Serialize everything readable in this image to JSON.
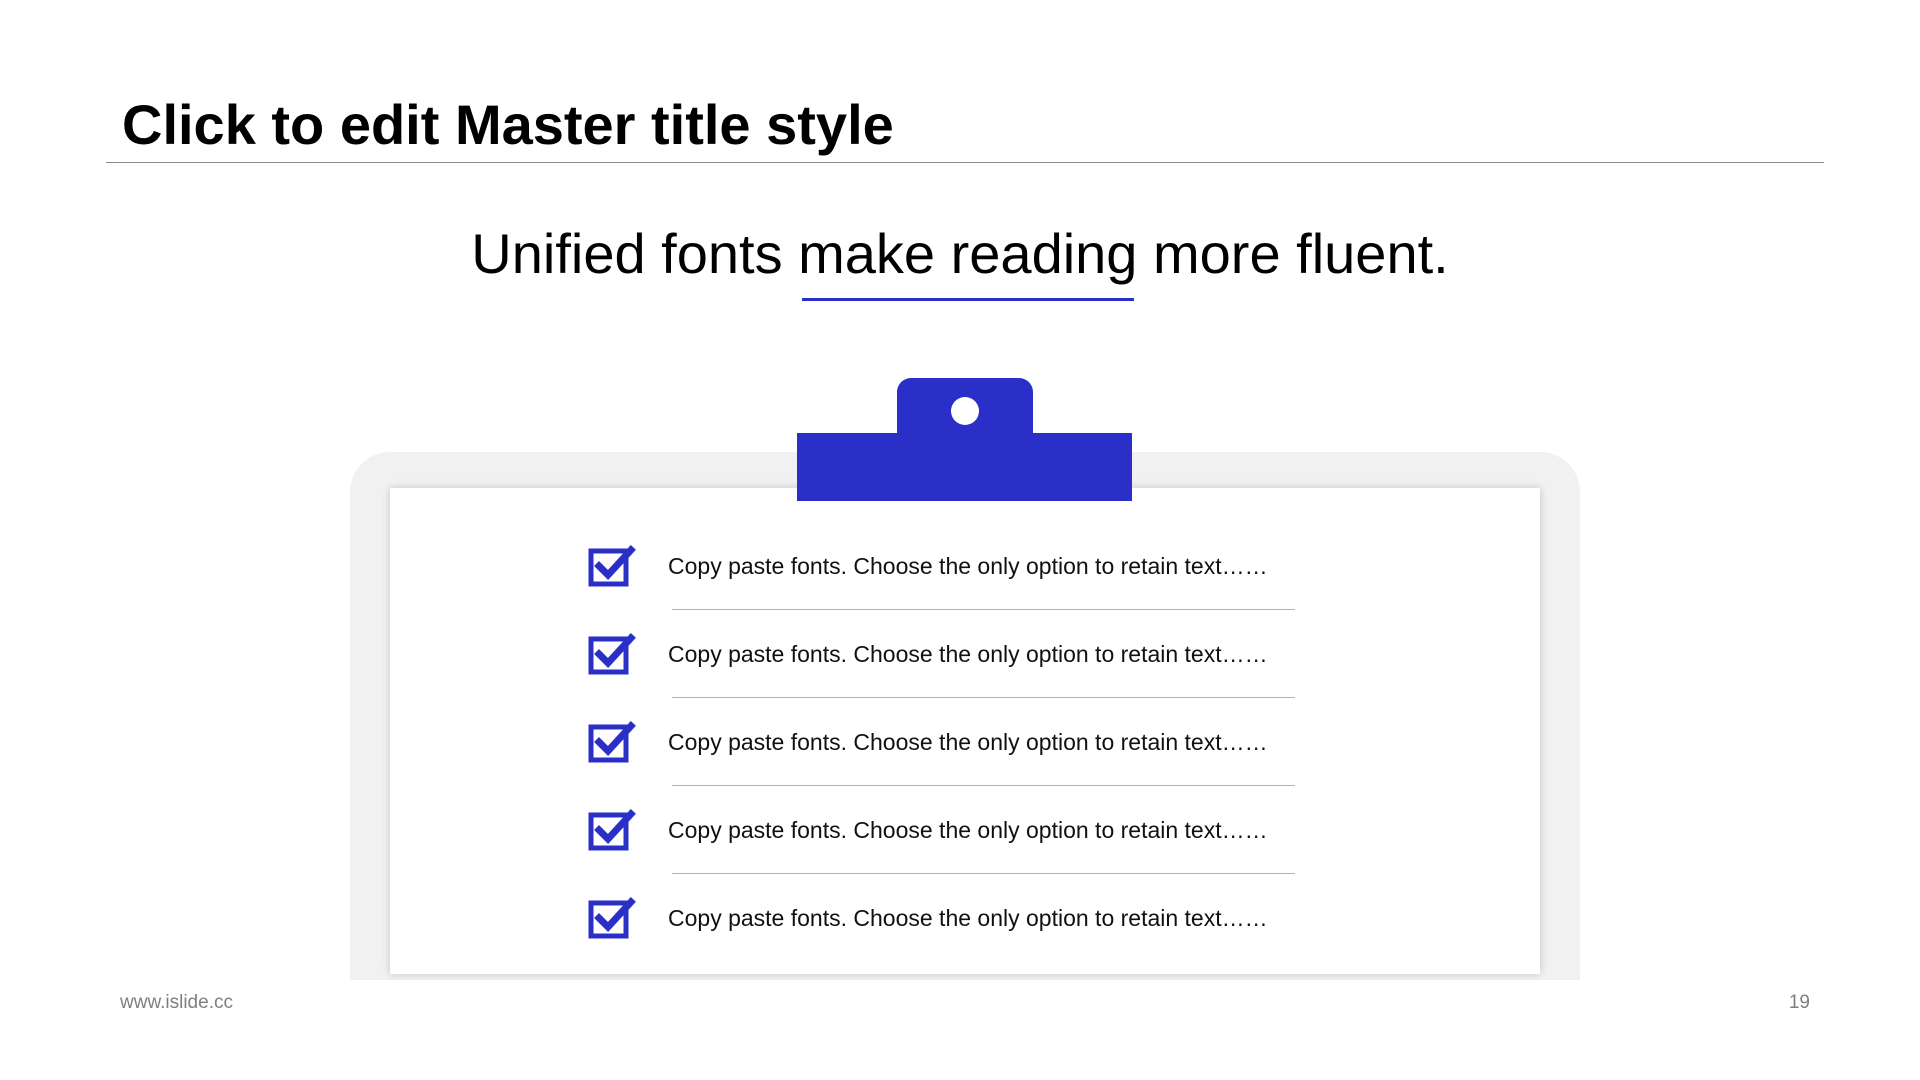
{
  "slide": {
    "title": "Click to edit Master title style",
    "subtitle": "Unified fonts make reading more fluent.",
    "checklist": [
      {
        "label": "Copy paste fonts. Choose the only option to retain text……",
        "checked": true
      },
      {
        "label": "Copy paste fonts. Choose the only option to retain text……",
        "checked": true
      },
      {
        "label": "Copy paste fonts. Choose the only option to retain text……",
        "checked": true
      },
      {
        "label": "Copy paste fonts. Choose the only option to retain text……",
        "checked": true
      },
      {
        "label": "Copy paste fonts. Choose the only option to retain text……",
        "checked": true
      }
    ]
  },
  "footer": {
    "url": "www.islide.cc",
    "page_number": "19"
  },
  "icons": {
    "checkbox": "checked-checkbox-icon",
    "clip": "clipboard-clip-icon"
  },
  "colors": {
    "accent": "#2a2fc8",
    "board": "#f1f1f1",
    "divider": "#b3b3b3",
    "footer_text": "#7f7f7f"
  }
}
